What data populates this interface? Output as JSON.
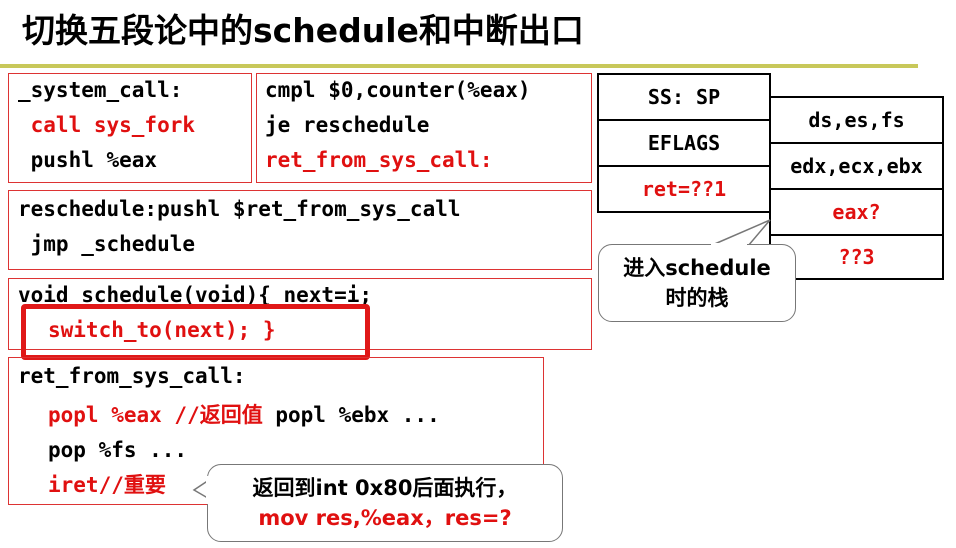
{
  "title": "切换五段论中的schedule和中断出口",
  "box1": {
    "line1": "_system_call:",
    "line2": " call sys_fork",
    "line3": " pushl %eax"
  },
  "box2": {
    "line1": "cmpl $0,counter(%eax)",
    "line2": "je reschedule",
    "line3": "ret_from_sys_call:"
  },
  "box3": {
    "line1": "reschedule:pushl $ret_from_sys_call",
    "line2": " jmp _schedule"
  },
  "box4": {
    "line1": "void schedule(void){ next=i;",
    "line2": "switch_to(next); }"
  },
  "box5": {
    "line1": "ret_from_sys_call:",
    "line2_red": "popl %eax //返回值",
    "line2_black": " popl %ebx ...",
    "line3": "pop %fs ...",
    "line4": "iret//重要"
  },
  "stack_left": [
    "SS: SP",
    "EFLAGS",
    "ret=??1"
  ],
  "stack_right": [
    "ds,es,fs",
    "edx,ecx,ebx",
    "eax?",
    "??3"
  ],
  "callout_stack": {
    "line1": "进入schedule",
    "line2": "时的栈"
  },
  "callout_iret": {
    "line1": "返回到int 0x80后面执行，",
    "line2": "mov res,%eax，res=?"
  },
  "colors": {
    "red": "#e01010",
    "rule": "#c8c85a",
    "box_border": "#d33"
  }
}
